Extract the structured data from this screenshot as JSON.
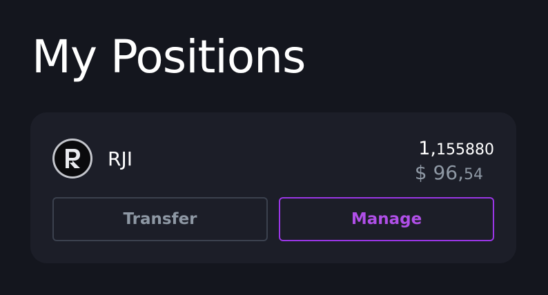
{
  "page": {
    "title": "My Positions"
  },
  "positions": [
    {
      "symbol": "RJI",
      "icon": "rji-token-logo-icon",
      "amount_integer": "1,",
      "amount_decimal": "155880",
      "value_currency": "$ ",
      "value_integer": "96,",
      "value_decimal": "54",
      "transfer_label": "Transfer",
      "manage_label": "Manage"
    }
  ],
  "colors": {
    "background": "#14161e",
    "card": "#1c1e28",
    "text_primary": "#ffffff",
    "text_muted": "#8e98a4",
    "accent": "#b04fe8",
    "accent_border": "#9a36e6"
  }
}
